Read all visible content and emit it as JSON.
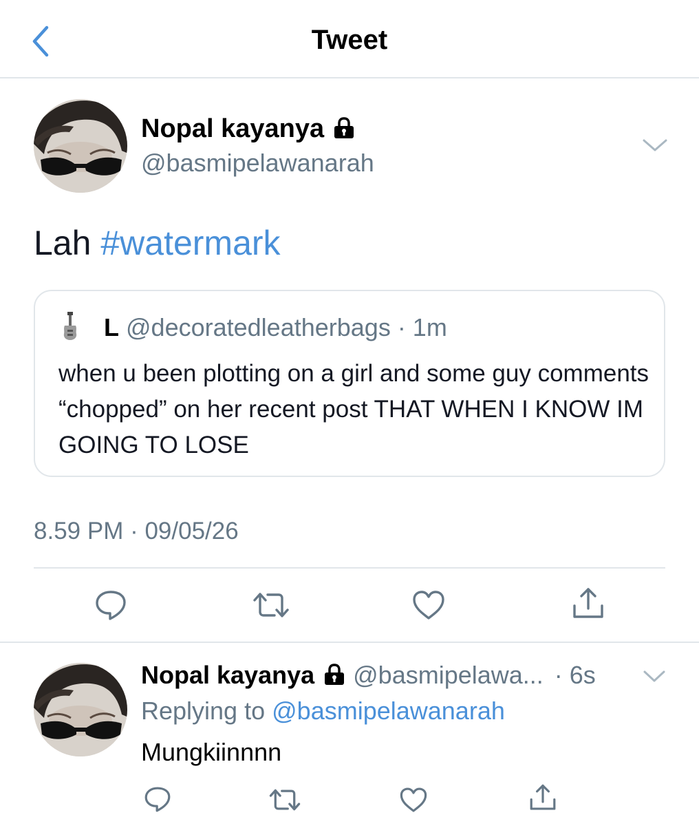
{
  "header": {
    "title": "Tweet"
  },
  "tweet": {
    "author_name": "Nopal kayanya",
    "author_handle": "@basmipelawanarah",
    "text": "Lah",
    "hashtag": "#watermark",
    "timestamp": "8.59 PM · 09/05/26"
  },
  "quote": {
    "name": "L",
    "handle_time": "@decoratedleatherbags · 1m",
    "body": "when u been plotting on a girl and some guy comments “chopped” on her recent post THAT WHEN I KNOW IM GOING TO LOSE"
  },
  "reply": {
    "author_name": "Nopal kayanya",
    "author_handle": "@basmipelawa...",
    "time": "· 6s",
    "replying_prefix": "Replying to",
    "replying_to": "@basmipelawanarah",
    "text": "Mungkiinnnn"
  },
  "icons": {
    "back": "chevron-left-icon",
    "lock": "lock-icon",
    "more": "chevron-down-icon",
    "reply": "comment-icon",
    "retweet": "retweet-icon",
    "like": "heart-icon",
    "share": "share-icon"
  },
  "colors": {
    "accent": "#4a90d9",
    "secondary_text": "#657786",
    "divider": "#e1e6ea",
    "icon": "#657786"
  }
}
